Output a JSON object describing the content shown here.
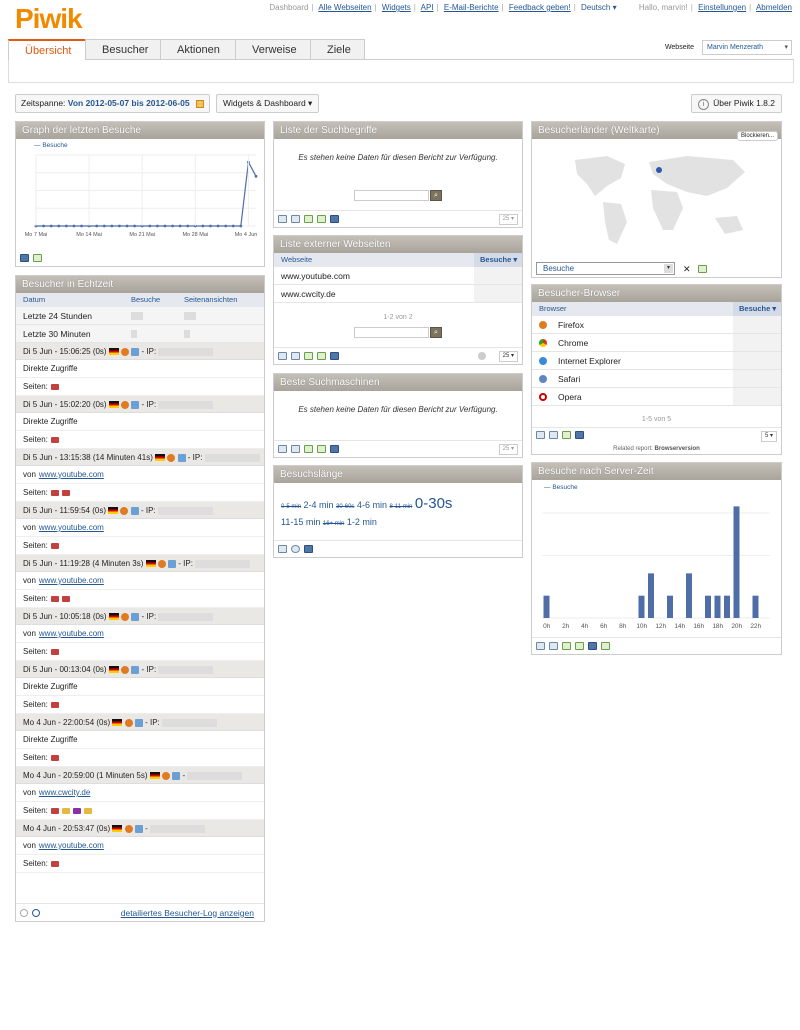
{
  "header": {
    "logo": "Piwik",
    "nav": [
      "Dashboard",
      "Alle Webseiten",
      "Widgets",
      "API",
      "E-Mail-Berichte",
      "Feedback geben!"
    ],
    "language": "Deutsch",
    "greeting": "Hallo, marvin!",
    "settings": "Einstellungen",
    "logout": "Abmelden"
  },
  "tabs": [
    "Übersicht",
    "Besucher",
    "Aktionen",
    "Verweise",
    "Ziele"
  ],
  "site": {
    "label": "Webseite",
    "value": "Marvin Menzerath"
  },
  "period": {
    "label": "Zeitspanne:",
    "value": "Von 2012-05-07 bis 2012-06-05"
  },
  "widgets_button": "Widgets & Dashboard",
  "about_button": "Über Piwik 1.8.2",
  "graph_widget": {
    "title": "Graph der letzten Besuche",
    "legend": "Besuche",
    "chart_data": {
      "type": "line",
      "x_ticks": [
        "Mo 7 Mai",
        "Mo 14 Mai",
        "Mo 21 Mai",
        "Mo 28 Mai",
        "Mo 4 Jun"
      ],
      "series": [
        {
          "name": "Besuche",
          "values": [
            0,
            0,
            0,
            0,
            0,
            0,
            0,
            0,
            0,
            0,
            0,
            0,
            0,
            0,
            0,
            0,
            0,
            0,
            0,
            0,
            0,
            0,
            0,
            0,
            0,
            0,
            0,
            0,
            9,
            7
          ]
        }
      ]
    }
  },
  "realtime": {
    "title": "Besucher in Echtzeit",
    "columns": [
      "Datum",
      "Besuche",
      "Seitenansichten"
    ],
    "rows": [
      "Letzte 24 Stunden",
      "Letzte 30 Minuten"
    ],
    "visits": [
      {
        "head": "Di 5 Jun - 15:06:25 (0s)",
        "ip": "- IP:",
        "source": "Direkte Zugriffe",
        "pages": "Seiten:",
        "folders": 1
      },
      {
        "head": "Di 5 Jun - 15:02:20 (0s)",
        "ip": "- IP:",
        "source": "Direkte Zugriffe",
        "pages": "Seiten:",
        "folders": 1
      },
      {
        "head": "Di 5 Jun - 13:15:38 (14 Minuten 41s)",
        "ip": "- IP:",
        "source": "von",
        "link": "www.youtube.com",
        "pages": "Seiten:",
        "folders": 2
      },
      {
        "head": "Di 5 Jun - 11:59:54 (0s)",
        "ip": "- IP:",
        "source": "von",
        "link": "www.youtube.com",
        "pages": "Seiten:",
        "folders": 1
      },
      {
        "head": "Di 5 Jun - 11:19:28 (4 Minuten 3s)",
        "ip": "- IP:",
        "source": "von",
        "link": "www.youtube.com",
        "pages": "Seiten:",
        "folders": 2
      },
      {
        "head": "Di 5 Jun - 10:05:18 (0s)",
        "ip": "- IP:",
        "source": "von",
        "link": "www.youtube.com",
        "pages": "Seiten:",
        "folders": 1
      },
      {
        "head": "Di 5 Jun - 00:13:04 (0s)",
        "ip": "- IP:",
        "source": "Direkte Zugriffe",
        "pages": "Seiten:",
        "folders": 1
      },
      {
        "head": "Mo 4 Jun - 22:00:54 (0s)",
        "ip": "- IP:",
        "source": "Direkte Zugriffe",
        "pages": "Seiten:",
        "folders": 1
      },
      {
        "head": "Mo 4 Jun - 20:59:00 (1 Minuten 5s)",
        "ip": "-",
        "source": "von",
        "link": "www.cwcity.de",
        "pages": "Seiten:",
        "folders": 4
      },
      {
        "head": "Mo 4 Jun - 20:53:47 (0s)",
        "ip": "-",
        "source": "von",
        "link": "www.youtube.com",
        "pages": "Seiten:",
        "folders": 1
      }
    ],
    "footer_link": "detailiertes Besucher-Log anzeigen"
  },
  "keywords": {
    "title": "Liste der Suchbegriffe",
    "nodata": "Es stehen keine Daten für diesen Bericht zur Verfügung.",
    "limit": "25"
  },
  "external": {
    "title": "Liste externer Webseiten",
    "col1": "Webseite",
    "col2": "Besuche",
    "rows": [
      "www.youtube.com",
      "www.cwcity.de"
    ],
    "pagination": "1-2 von 2",
    "limit": "25"
  },
  "searchengines": {
    "title": "Beste Suchmaschinen",
    "nodata": "Es stehen keine Daten für diesen Bericht zur Verfügung.",
    "limit": "25"
  },
  "duration": {
    "title": "Besuchslänge",
    "tags": [
      "0-5 min",
      "2-4 min",
      "30-60s",
      "4-6 min",
      "8-11 min",
      "0-30s",
      "11-15 min",
      "16+ min",
      "1-2 min"
    ]
  },
  "map": {
    "title": "Besucherländer (Weltkarte)",
    "block": "Blockieren...",
    "metric": "Besuche"
  },
  "browsers": {
    "title": "Besucher-Browser",
    "col1": "Browser",
    "col2": "Besuche",
    "rows": [
      "Firefox",
      "Chrome",
      "Internet Explorer",
      "Safari",
      "Opera"
    ],
    "pagination": "1-5 von 5",
    "related_label": "Related report:",
    "related_value": "Browserversion",
    "limit": "5"
  },
  "servertime": {
    "title": "Besuche nach Server-Zeit",
    "legend": "Besuche",
    "chart_data": {
      "type": "bar",
      "categories": [
        "0h",
        "1h",
        "2h",
        "3h",
        "4h",
        "5h",
        "6h",
        "7h",
        "8h",
        "9h",
        "10h",
        "11h",
        "12h",
        "13h",
        "14h",
        "15h",
        "16h",
        "17h",
        "18h",
        "19h",
        "20h",
        "21h",
        "22h",
        "23h"
      ],
      "x_ticks": [
        "0h",
        "2h",
        "4h",
        "6h",
        "8h",
        "10h",
        "12h",
        "14h",
        "16h",
        "18h",
        "20h",
        "22h"
      ],
      "series": [
        {
          "name": "Besuche",
          "values": [
            1,
            0,
            0,
            0,
            0,
            0,
            0,
            0,
            0,
            0,
            1,
            2,
            0,
            1,
            0,
            2,
            0,
            1,
            1,
            1,
            5,
            0,
            1,
            0
          ]
        }
      ]
    }
  },
  "colors": {
    "accent": "#e05a14",
    "link": "#255792",
    "bar": "#4f6ea8"
  }
}
